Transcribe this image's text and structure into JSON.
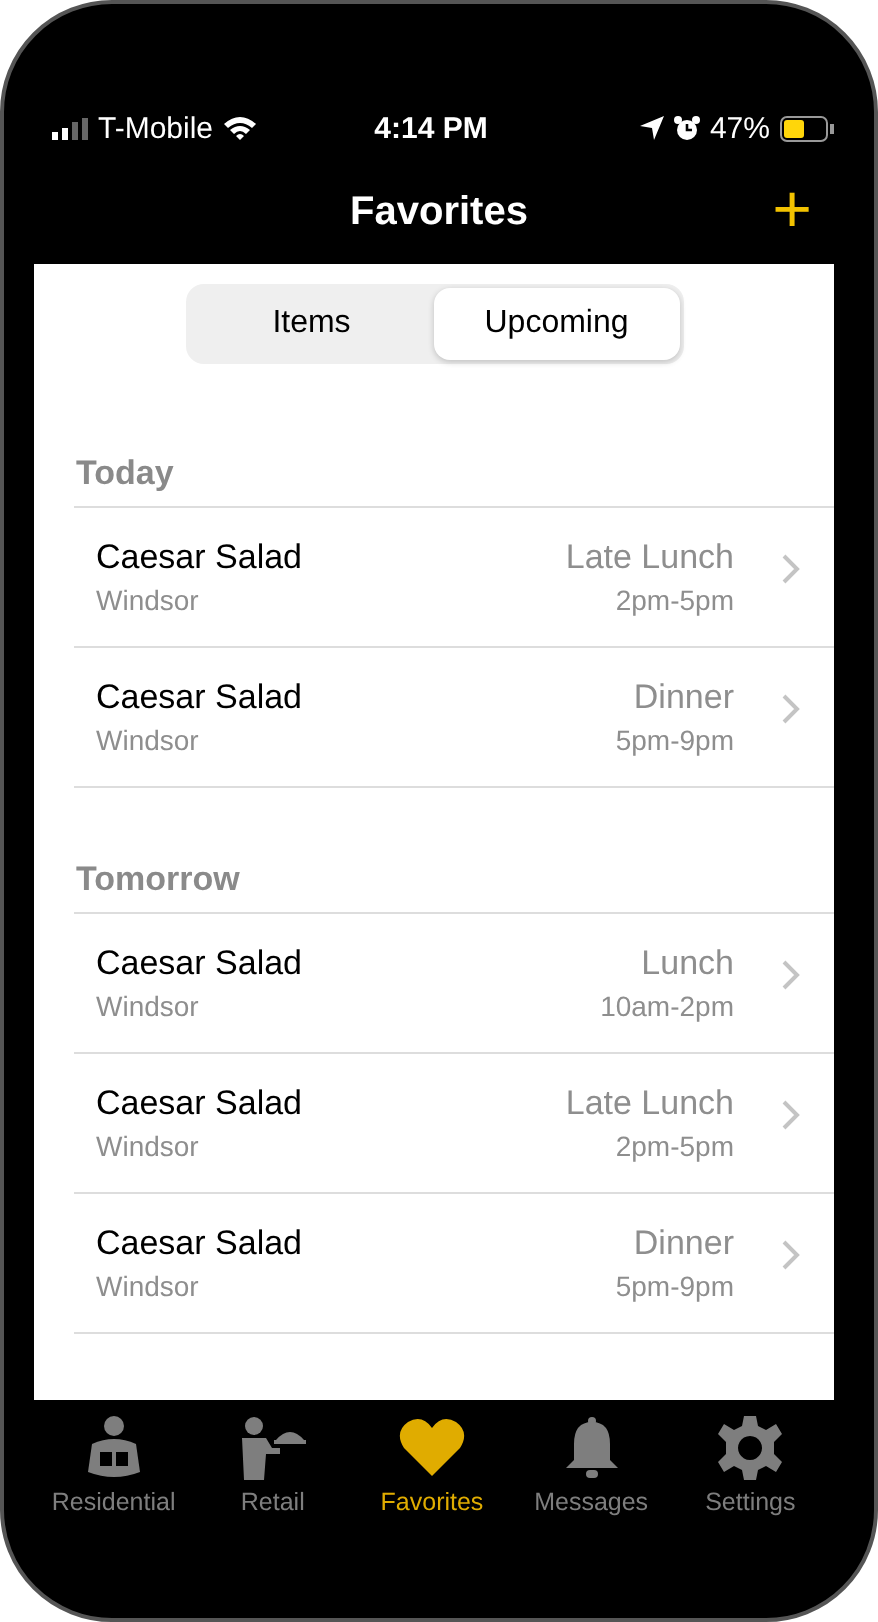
{
  "status_bar": {
    "carrier": "T-Mobile",
    "time": "4:14 PM",
    "battery": "47%"
  },
  "nav": {
    "title": "Favorites",
    "action": "+"
  },
  "segments": [
    {
      "label": "Items",
      "selected": false
    },
    {
      "label": "Upcoming",
      "selected": true
    }
  ],
  "sections": [
    {
      "title": "Today",
      "rows": [
        {
          "name": "Caesar Salad",
          "location": "Windsor",
          "meal": "Late Lunch",
          "hours": "2pm-5pm"
        },
        {
          "name": "Caesar Salad",
          "location": "Windsor",
          "meal": "Dinner",
          "hours": "5pm-9pm"
        }
      ]
    },
    {
      "title": "Tomorrow",
      "rows": [
        {
          "name": "Caesar Salad",
          "location": "Windsor",
          "meal": "Lunch",
          "hours": "10am-2pm"
        },
        {
          "name": "Caesar Salad",
          "location": "Windsor",
          "meal": "Late Lunch",
          "hours": "2pm-5pm"
        },
        {
          "name": "Caesar Salad",
          "location": "Windsor",
          "meal": "Dinner",
          "hours": "5pm-9pm"
        }
      ]
    }
  ],
  "tab_bar": [
    {
      "label": "Residential",
      "selected": false
    },
    {
      "label": "Retail",
      "selected": false
    },
    {
      "label": "Favorites",
      "selected": true
    },
    {
      "label": "Messages",
      "selected": false
    },
    {
      "label": "Settings",
      "selected": false
    }
  ]
}
